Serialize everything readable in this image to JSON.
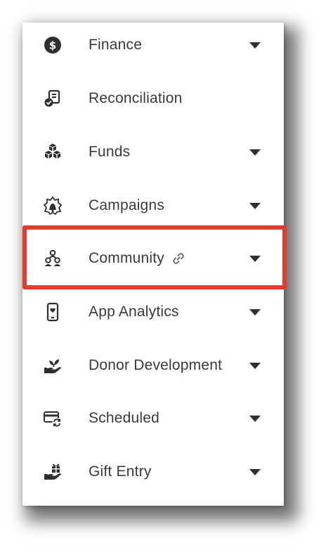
{
  "menu": {
    "items": [
      {
        "label": "Finance",
        "icon": "dollar-circle-icon",
        "has_caret": true,
        "linked": false
      },
      {
        "label": "Reconciliation",
        "icon": "reconciliation-check-icon",
        "has_caret": false,
        "linked": false
      },
      {
        "label": "Funds",
        "icon": "cubes-icon",
        "has_caret": true,
        "linked": false
      },
      {
        "label": "Campaigns",
        "icon": "campaign-bell-icon",
        "has_caret": true,
        "linked": false
      },
      {
        "label": "Community",
        "icon": "community-people-icon",
        "has_caret": true,
        "linked": true
      },
      {
        "label": "App Analytics",
        "icon": "mobile-heart-icon",
        "has_caret": true,
        "linked": false
      },
      {
        "label": "Donor Development",
        "icon": "hand-plant-icon",
        "has_caret": true,
        "linked": false
      },
      {
        "label": "Scheduled",
        "icon": "card-sync-icon",
        "has_caret": true,
        "linked": false
      },
      {
        "label": "Gift Entry",
        "icon": "hand-gift-icon",
        "has_caret": true,
        "linked": false
      }
    ]
  },
  "highlight": {
    "target": "Community",
    "color": "#e03b2c"
  },
  "colors": {
    "icon": "#2f2f2f",
    "text": "#3a3a3a",
    "background": "#ffffff"
  }
}
